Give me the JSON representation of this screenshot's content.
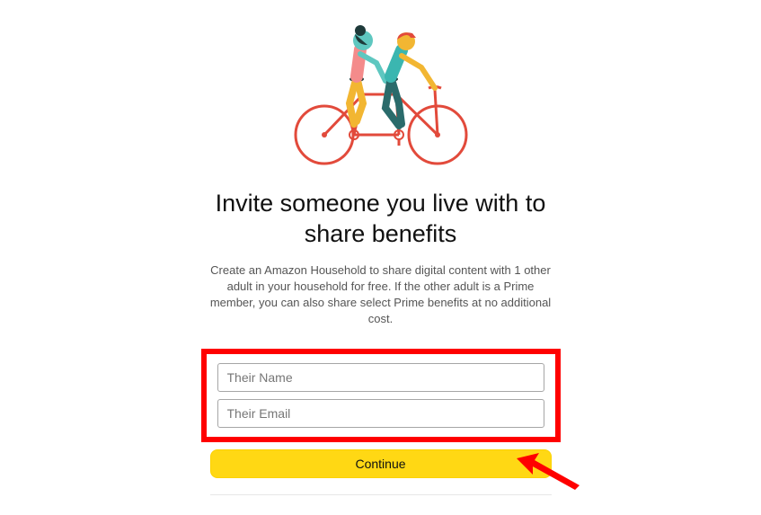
{
  "illustration": {
    "name": "tandem-bike-illustration",
    "colors": {
      "bike": "#e24a3b",
      "person1_top": "#f48b8b",
      "person1_bottom": "#f2b632",
      "person1_skin": "#5ec7c0",
      "person1_hair": "#1e3a3a",
      "person2_top": "#3bb6b0",
      "person2_bottom": "#2a6b6b",
      "person2_cap": "#e24a3b",
      "person2_skin": "#f2b632"
    }
  },
  "heading": "Invite someone you live with to share benefits",
  "description": "Create an Amazon Household to share digital content with 1 other adult in your household for free. If the other adult is a Prime member, you can also share select Prime benefits at no additional cost.",
  "form": {
    "name_placeholder": "Their Name",
    "name_value": "",
    "email_placeholder": "Their Email",
    "email_value": ""
  },
  "continue_label": "Continue",
  "annotation": {
    "highlight_color": "#ff0000",
    "arrow_color": "#ff0000"
  }
}
